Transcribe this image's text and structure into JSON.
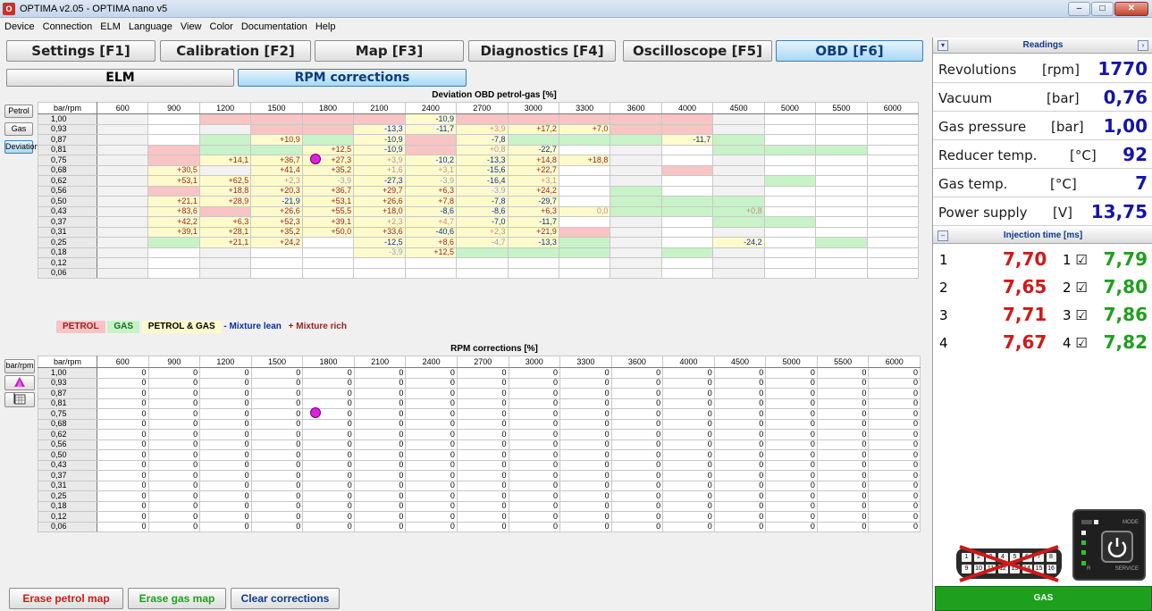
{
  "window": {
    "title": "OPTIMA v2.05  -  OPTIMA nano v5",
    "app_icon": "optima-icon"
  },
  "menu": [
    "Device",
    "Connection",
    "ELM",
    "Language",
    "View",
    "Color",
    "Documentation",
    "Help"
  ],
  "tabs": [
    {
      "label": "Settings [F1]",
      "active": false
    },
    {
      "label": "Calibration [F2]",
      "active": false
    },
    {
      "label": "Map [F3]",
      "active": false
    },
    {
      "label": "Diagnostics [F4]",
      "active": false
    },
    {
      "label": "Oscilloscope [F5]",
      "active": false
    },
    {
      "label": "OBD [F6]",
      "active": true
    }
  ],
  "subtabs": [
    {
      "label": "ELM",
      "active": false
    },
    {
      "label": "RPM corrections",
      "active": true
    }
  ],
  "deviation": {
    "caption": "Deviation OBD petrol-gas [%]",
    "side_buttons": [
      {
        "label": "Petrol",
        "active": false
      },
      {
        "label": "Gas",
        "active": false
      },
      {
        "label": "Deviation",
        "active": true
      }
    ],
    "corner": "bar/rpm",
    "columns": [
      "600",
      "900",
      "1200",
      "1500",
      "1800",
      "2100",
      "2400",
      "2700",
      "3000",
      "3300",
      "3600",
      "4000",
      "4500",
      "5000",
      "5500",
      "6000"
    ],
    "rows": [
      {
        "label": "1,00",
        "cells": [
          [
            "",
            ""
          ],
          [
            "",
            ""
          ],
          [
            "p",
            ""
          ],
          [
            "p",
            ""
          ],
          [
            "p",
            ""
          ],
          [
            "p",
            ""
          ],
          [
            "b",
            "-10,9"
          ],
          [
            "p",
            ""
          ],
          [
            "p",
            ""
          ],
          [
            "p",
            ""
          ],
          [
            "p",
            ""
          ],
          [
            "p",
            ""
          ],
          [
            "",
            ""
          ],
          [
            "",
            ""
          ],
          [
            "",
            ""
          ],
          [
            "",
            ""
          ]
        ]
      },
      {
        "label": "0,93",
        "cells": [
          [
            "",
            ""
          ],
          [
            "",
            ""
          ],
          [
            "",
            ""
          ],
          [
            "p",
            ""
          ],
          [
            "p",
            ""
          ],
          [
            "b",
            "-13,3"
          ],
          [
            "b",
            "-11,7"
          ],
          [
            "b",
            "+3,9"
          ],
          [
            "b",
            "+17,2"
          ],
          [
            "b",
            "+7,0"
          ],
          [
            "p",
            ""
          ],
          [
            "p",
            ""
          ],
          [
            "",
            ""
          ],
          [
            "",
            ""
          ],
          [
            "",
            ""
          ],
          [
            "",
            ""
          ]
        ]
      },
      {
        "label": "0,87",
        "cells": [
          [
            "",
            ""
          ],
          [
            "",
            ""
          ],
          [
            "g",
            ""
          ],
          [
            "b",
            "+10,9"
          ],
          [
            "g",
            ""
          ],
          [
            "b",
            "-10,9"
          ],
          [
            "p",
            ""
          ],
          [
            "b",
            "-7,8"
          ],
          [
            "g",
            ""
          ],
          [
            "g",
            ""
          ],
          [
            "g",
            ""
          ],
          [
            "b",
            "-11,7"
          ],
          [
            "g",
            ""
          ],
          [
            "",
            ""
          ],
          [
            "",
            ""
          ],
          [
            "",
            ""
          ]
        ]
      },
      {
        "label": "0,81",
        "cells": [
          [
            "",
            ""
          ],
          [
            "p",
            ""
          ],
          [
            "g",
            ""
          ],
          [
            "g",
            ""
          ],
          [
            "b",
            "+12,5"
          ],
          [
            "b",
            "-10,9"
          ],
          [
            "p",
            ""
          ],
          [
            "b",
            "+0,8"
          ],
          [
            "b",
            "-22,7"
          ],
          [
            "",
            ""
          ],
          [
            "",
            ""
          ],
          [
            "",
            ""
          ],
          [
            "g",
            ""
          ],
          [
            "g",
            ""
          ],
          [
            "g",
            ""
          ],
          [
            "",
            ""
          ]
        ]
      },
      {
        "label": "0,75",
        "cells": [
          [
            "",
            ""
          ],
          [
            "p",
            ""
          ],
          [
            "b",
            "+14,1"
          ],
          [
            "b",
            "+36,7"
          ],
          [
            "b",
            "+27,3"
          ],
          [
            "b",
            "+3,9"
          ],
          [
            "b",
            "-10,2"
          ],
          [
            "b",
            "-13,3"
          ],
          [
            "b",
            "+14,8"
          ],
          [
            "b",
            "+18,8"
          ],
          [
            "",
            ""
          ],
          [
            "",
            ""
          ],
          [
            "",
            ""
          ],
          [
            "",
            ""
          ],
          [
            "",
            ""
          ],
          [
            "",
            ""
          ]
        ]
      },
      {
        "label": "0,68",
        "cells": [
          [
            "",
            ""
          ],
          [
            "b",
            "+30,5"
          ],
          [
            "",
            ""
          ],
          [
            "b",
            "+41,4"
          ],
          [
            "b",
            "+35,2"
          ],
          [
            "b",
            "+1,6"
          ],
          [
            "b",
            "+3,1"
          ],
          [
            "b",
            "-15,6"
          ],
          [
            "b",
            "+22,7"
          ],
          [
            "",
            ""
          ],
          [
            "",
            ""
          ],
          [
            "p",
            ""
          ],
          [
            "",
            ""
          ],
          [
            "",
            ""
          ],
          [
            "",
            ""
          ],
          [
            "",
            ""
          ]
        ]
      },
      {
        "label": "0,62",
        "cells": [
          [
            "",
            ""
          ],
          [
            "b",
            "+53,1"
          ],
          [
            "b",
            "+62,5"
          ],
          [
            "b",
            "+2,3"
          ],
          [
            "b",
            "-3,9"
          ],
          [
            "b",
            "-27,3"
          ],
          [
            "b",
            "-3,9"
          ],
          [
            "b",
            "-16,4"
          ],
          [
            "b",
            "+3,1"
          ],
          [
            "",
            ""
          ],
          [
            "",
            ""
          ],
          [
            "",
            ""
          ],
          [
            "",
            ""
          ],
          [
            "g",
            ""
          ],
          [
            "",
            ""
          ],
          [
            "",
            ""
          ]
        ]
      },
      {
        "label": "0,56",
        "cells": [
          [
            "",
            ""
          ],
          [
            "p",
            ""
          ],
          [
            "b",
            "+18,8"
          ],
          [
            "b",
            "+20,3"
          ],
          [
            "b",
            "+36,7"
          ],
          [
            "b",
            "+29,7"
          ],
          [
            "b",
            "+6,3"
          ],
          [
            "b",
            "-3,9"
          ],
          [
            "b",
            "+24,2"
          ],
          [
            "",
            ""
          ],
          [
            "g",
            ""
          ],
          [
            "",
            ""
          ],
          [
            "",
            ""
          ],
          [
            "",
            ""
          ],
          [
            "",
            ""
          ],
          [
            "",
            ""
          ]
        ]
      },
      {
        "label": "0,50",
        "cells": [
          [
            "",
            ""
          ],
          [
            "b",
            "+21,1"
          ],
          [
            "b",
            "+28,9"
          ],
          [
            "b",
            "-21,9"
          ],
          [
            "b",
            "+53,1"
          ],
          [
            "b",
            "+26,6"
          ],
          [
            "b",
            "+7,8"
          ],
          [
            "b",
            "-7,8"
          ],
          [
            "b",
            "-29,7"
          ],
          [
            "",
            ""
          ],
          [
            "g",
            ""
          ],
          [
            "g",
            ""
          ],
          [
            "g",
            ""
          ],
          [
            "",
            ""
          ],
          [
            "",
            ""
          ],
          [
            "",
            ""
          ]
        ]
      },
      {
        "label": "0,43",
        "cells": [
          [
            "",
            ""
          ],
          [
            "b",
            "+83,6"
          ],
          [
            "p",
            ""
          ],
          [
            "b",
            "+26,6"
          ],
          [
            "b",
            "+55,5"
          ],
          [
            "b",
            "+18,0"
          ],
          [
            "b",
            "-8,6"
          ],
          [
            "b",
            "-8,6"
          ],
          [
            "b",
            "+6,3"
          ],
          [
            "b",
            "0,0"
          ],
          [
            "g",
            ""
          ],
          [
            "g",
            ""
          ],
          [
            "g",
            "+0,8"
          ],
          [
            "",
            ""
          ],
          [
            "",
            ""
          ],
          [
            "",
            ""
          ]
        ]
      },
      {
        "label": "0,37",
        "cells": [
          [
            "",
            ""
          ],
          [
            "b",
            "+42,2"
          ],
          [
            "b",
            "+6,3"
          ],
          [
            "b",
            "+52,3"
          ],
          [
            "b",
            "+39,1"
          ],
          [
            "b",
            "+2,3"
          ],
          [
            "b",
            "+4,7"
          ],
          [
            "b",
            "-7,0"
          ],
          [
            "b",
            "-11,7"
          ],
          [
            "",
            ""
          ],
          [
            "",
            ""
          ],
          [
            "",
            ""
          ],
          [
            "g",
            ""
          ],
          [
            "g",
            ""
          ],
          [
            "",
            ""
          ],
          [
            "",
            ""
          ]
        ]
      },
      {
        "label": "0,31",
        "cells": [
          [
            "",
            ""
          ],
          [
            "b",
            "+39,1"
          ],
          [
            "b",
            "+28,1"
          ],
          [
            "b",
            "+35,2"
          ],
          [
            "b",
            "+50,0"
          ],
          [
            "b",
            "+33,6"
          ],
          [
            "b",
            "-40,6"
          ],
          [
            "b",
            "+2,3"
          ],
          [
            "b",
            "+21,9"
          ],
          [
            "p",
            ""
          ],
          [
            "",
            ""
          ],
          [
            "",
            ""
          ],
          [
            "",
            ""
          ],
          [
            "",
            ""
          ],
          [
            "",
            ""
          ],
          [
            "",
            ""
          ]
        ]
      },
      {
        "label": "0,25",
        "cells": [
          [
            "",
            ""
          ],
          [
            "g",
            ""
          ],
          [
            "b",
            "+21,1"
          ],
          [
            "b",
            "+24,2"
          ],
          [
            "",
            ""
          ],
          [
            "b",
            "-12,5"
          ],
          [
            "b",
            "+8,6"
          ],
          [
            "b",
            "-4,7"
          ],
          [
            "b",
            "-13,3"
          ],
          [
            "g",
            ""
          ],
          [
            "",
            ""
          ],
          [
            "",
            ""
          ],
          [
            "b",
            "-24,2"
          ],
          [
            "",
            ""
          ],
          [
            "g",
            ""
          ],
          [
            "",
            ""
          ]
        ]
      },
      {
        "label": "0,18",
        "cells": [
          [
            "",
            ""
          ],
          [
            "",
            ""
          ],
          [
            "",
            ""
          ],
          [
            "",
            ""
          ],
          [
            "",
            ""
          ],
          [
            "b",
            "-3,9"
          ],
          [
            "b",
            "+12,5"
          ],
          [
            "g",
            ""
          ],
          [
            "g",
            ""
          ],
          [
            "g",
            ""
          ],
          [
            "",
            ""
          ],
          [
            "g",
            ""
          ],
          [
            "",
            ""
          ],
          [
            "",
            ""
          ],
          [
            "",
            ""
          ],
          [
            "",
            ""
          ]
        ]
      },
      {
        "label": "0,12",
        "cells": [
          [
            "",
            ""
          ],
          [
            "",
            ""
          ],
          [
            "",
            ""
          ],
          [
            "",
            ""
          ],
          [
            "",
            ""
          ],
          [
            "",
            ""
          ],
          [
            "",
            ""
          ],
          [
            "",
            ""
          ],
          [
            "",
            ""
          ],
          [
            "",
            ""
          ],
          [
            "",
            ""
          ],
          [
            "",
            ""
          ],
          [
            "",
            ""
          ],
          [
            "",
            ""
          ],
          [
            "",
            ""
          ],
          [
            "",
            ""
          ]
        ]
      },
      {
        "label": "0,06",
        "cells": [
          [
            "",
            ""
          ],
          [
            "",
            ""
          ],
          [
            "",
            ""
          ],
          [
            "",
            ""
          ],
          [
            "",
            ""
          ],
          [
            "",
            ""
          ],
          [
            "",
            ""
          ],
          [
            "",
            ""
          ],
          [
            "",
            ""
          ],
          [
            "",
            ""
          ],
          [
            "",
            ""
          ],
          [
            "",
            ""
          ],
          [
            "",
            ""
          ],
          [
            "",
            ""
          ],
          [
            "",
            ""
          ],
          [
            "",
            ""
          ]
        ]
      }
    ],
    "legend": {
      "petrol": "PETROL",
      "gas": "GAS",
      "petrol_gas": "PETROL & GAS",
      "lean": "- Mixture lean",
      "rich": "+ Mixture rich"
    }
  },
  "rpm": {
    "caption": "RPM corrections [%]",
    "side_button": "bar/rpm",
    "corner": "bar/rpm",
    "columns": [
      "600",
      "900",
      "1200",
      "1500",
      "1800",
      "2100",
      "2400",
      "2700",
      "3000",
      "3300",
      "3600",
      "4000",
      "4500",
      "5000",
      "5500",
      "6000"
    ],
    "rows": [
      "1,00",
      "0,93",
      "0,87",
      "0,81",
      "0,75",
      "0,68",
      "0,62",
      "0,56",
      "0,50",
      "0,43",
      "0,37",
      "0,31",
      "0,25",
      "0,18",
      "0,12",
      "0,06"
    ],
    "cell_value": "0"
  },
  "actions": {
    "erase_petrol": "Erase petrol map",
    "erase_gas": "Erase gas map",
    "clear": "Clear corrections"
  },
  "readings": {
    "title": "Readings",
    "items": [
      {
        "label": "Revolutions",
        "unit": "[rpm]",
        "value": "1770"
      },
      {
        "label": "Vacuum",
        "unit": "[bar]",
        "value": "0,76"
      },
      {
        "label": "Gas pressure",
        "unit": "[bar]",
        "value": "1,00"
      },
      {
        "label": "Reducer temp.",
        "unit": "[°C]",
        "value": "92"
      },
      {
        "label": "Gas temp.",
        "unit": "[°C]",
        "value": "7"
      },
      {
        "label": "Power supply",
        "unit": "[V]",
        "value": "13,75"
      }
    ]
  },
  "injection": {
    "title": "Injection time [ms]",
    "rows": [
      {
        "n": "1",
        "petrol": "7,70",
        "ch": "1 ☑",
        "gas": "7,79"
      },
      {
        "n": "2",
        "petrol": "7,65",
        "ch": "2 ☑",
        "gas": "7,80"
      },
      {
        "n": "3",
        "petrol": "7,71",
        "ch": "3 ☑",
        "gas": "7,86"
      },
      {
        "n": "4",
        "petrol": "7,67",
        "ch": "4 ☑",
        "gas": "7,82"
      }
    ]
  },
  "controller": {
    "mode": "MODE",
    "service": "SERVICE",
    "r": "R"
  },
  "obd_pins": [
    "1",
    "2",
    "3",
    "4",
    "5",
    "6",
    "7",
    "8",
    "9",
    "10",
    "11",
    "12",
    "13",
    "14",
    "15",
    "16"
  ],
  "status": {
    "fuel": "GAS"
  },
  "colors": {
    "petrol": "#f8c4c4",
    "gas": "#c8f3c8",
    "both": "#fdfbcc",
    "lean": "#0a2f9c",
    "rich": "#9a1f1f",
    "marker": "#e020e0"
  },
  "marker": {
    "rpm": "1800",
    "bar": "0,81"
  }
}
